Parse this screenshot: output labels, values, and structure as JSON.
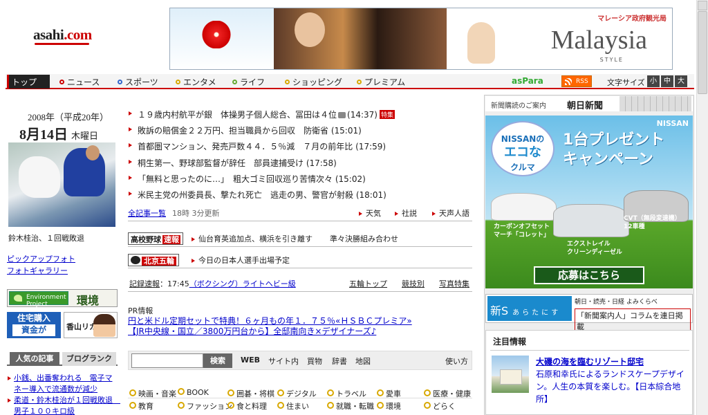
{
  "header": {
    "logo_a": "asahi",
    "logo_b": ".com",
    "banner": {
      "top": "マレーシア政府観光局",
      "main": "Malaysia",
      "sub": "STYLE"
    }
  },
  "nav": {
    "items": [
      {
        "label": "トップ",
        "color": "#c00000"
      },
      {
        "label": "ニュース",
        "color": "#c00000"
      },
      {
        "label": "スポーツ",
        "color": "#3366cc"
      },
      {
        "label": "エンタメ",
        "color": "#d8a800"
      },
      {
        "label": "ライフ",
        "color": "#66aa33"
      },
      {
        "label": "ショッピング",
        "color": "#d8a800"
      },
      {
        "label": "プレミアム",
        "color": "#d8a800"
      }
    ],
    "aspara": "asPara",
    "rss": "RSS",
    "font_size_label": "文字サイズ",
    "font_sizes": [
      "小",
      "中",
      "大"
    ]
  },
  "left": {
    "date_line1": "2008年（平成20年）",
    "date_main": "8月14日",
    "date_day": "木曜日",
    "photo_caption": "鈴木桂治、１回戦敗退",
    "link_pickup": "ピックアップフォト",
    "link_gallery": "フォトギャラリー",
    "kankyo_badge": "Environment Project",
    "kankyo_label": "環境",
    "jutaku_line1": "住宅購入",
    "jutaku_line2": "資金が",
    "rika_label": "香山リカ",
    "tab_popular": "人気の記事",
    "tab_blog": "ブログランク",
    "ranking": [
      "小銭、出番奪われる　電子マネー導入で流通数が減少",
      "柔道・鈴木桂治が１回戦敗退　男子１００キロ級"
    ]
  },
  "news": {
    "items": [
      {
        "title": "１９歳内村航平が銀　体操男子個人総合、冨田は４位",
        "time": "(14:37)",
        "camera": true,
        "special": "特集"
      },
      {
        "title": "敗訴の賠償金２２万円、担当職員から回収　防衛省",
        "time": "(15:01)"
      },
      {
        "title": "首都圏マンション、発売戸数４４．５％減　７月の前年比",
        "time": "(17:59)"
      },
      {
        "title": "桐生第一、野球部監督が辞任　部員逮捕受け",
        "time": "(17:58)"
      },
      {
        "title": "「無料と思ったのに…」　粗大ゴミ回収巡り苦情次々",
        "time": "(15:02)"
      },
      {
        "title": "米民主党の州委員長、撃たれ死亡　逃走の男、警官が射殺",
        "time": "(18:01)"
      }
    ],
    "all_articles": "全記事一覧",
    "updated": "18時 3分更新",
    "weather": "天気",
    "editorial": "社説",
    "tenseijingo": "天声人語"
  },
  "koko": {
    "badge": "高校野球",
    "badge_red": "速報",
    "text1": "仙台育英追加点、横浜を引き離す",
    "text2": "準々決勝組み合わせ"
  },
  "beijing": {
    "badge_red": "北京五輪",
    "text": "今日の日本人選手出場予定"
  },
  "kiroku": {
    "label": "記録速報",
    "time": "：17:45",
    "event": "（ボクシング）ライトヘビー級",
    "gorin_top": "五輪トップ",
    "sports": "競技別",
    "photos": "写真特集"
  },
  "pr": {
    "heading": "PR情報",
    "line1": "円と米ドル定期セットで特典！６ヶ月もの年１．７５％«ＨＳＢＣプレミア»",
    "line2": "【JR中央線・国立／3800万円台から】全邸南向き×デザイナーズ♪"
  },
  "search": {
    "placeholder": "",
    "button": "検索",
    "web": "WEB",
    "site": "サイト内",
    "shopping": "買物",
    "dict": "辞書",
    "map": "地図",
    "howto": "使い方"
  },
  "categories": [
    [
      "映画・音楽",
      "BOOK",
      "囲碁・将棋",
      "デジタル",
      "トラベル",
      "愛車",
      "医療・健康"
    ],
    [
      "教育",
      "ファッション",
      "食と料理",
      "住まい",
      "就職・転職",
      "環境",
      "どらく"
    ]
  ],
  "right": {
    "sub_label": "新聞購読のご案内",
    "sub_brand": "朝日新聞",
    "nissan": {
      "logo": [
        "NISSANの",
        "エコな",
        "クルマ"
      ],
      "brand": "NISSAN",
      "title1": "1台プレゼント",
      "title2": "キャンペーン",
      "car1": [
        "カーボンオフセット",
        "マーチ「コレット」"
      ],
      "car2": [
        "エクストレイル",
        "クリーンディーゼル"
      ],
      "car3": [
        "CVT（無段変速機）",
        "12車種"
      ],
      "go": "応募はこちら"
    },
    "atari": {
      "logo": "新S",
      "logo_sub": "あらたにす",
      "line1": "朝日・読売・日経 よみくらべ",
      "line2": "「新聞案内人」コラムを連日掲載"
    },
    "chumoku": {
      "heading": "注目情報",
      "title": "大磯の海を臨むリゾート邸宅",
      "desc": "石原和幸氏によるランドスケープデザイン。人生の本質を楽しむ。【日本綜合地所】"
    }
  }
}
